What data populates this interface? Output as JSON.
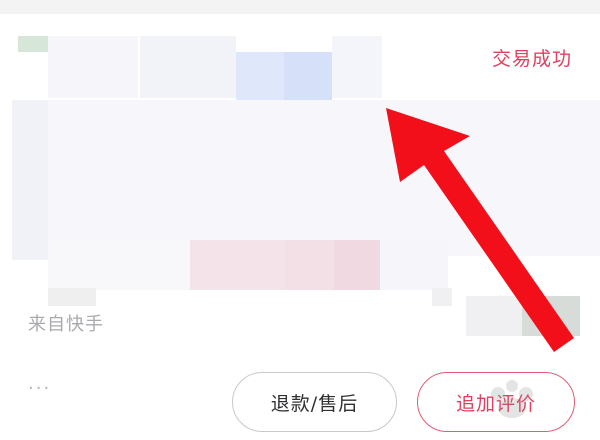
{
  "order": {
    "status": "交易成功",
    "source": "来自快手",
    "more_dots": "···"
  },
  "actions": {
    "refund_label": "退款/售后",
    "review_label": "追加评价"
  },
  "colors": {
    "accent": "#e0405f",
    "arrow": "#f20f1a"
  }
}
